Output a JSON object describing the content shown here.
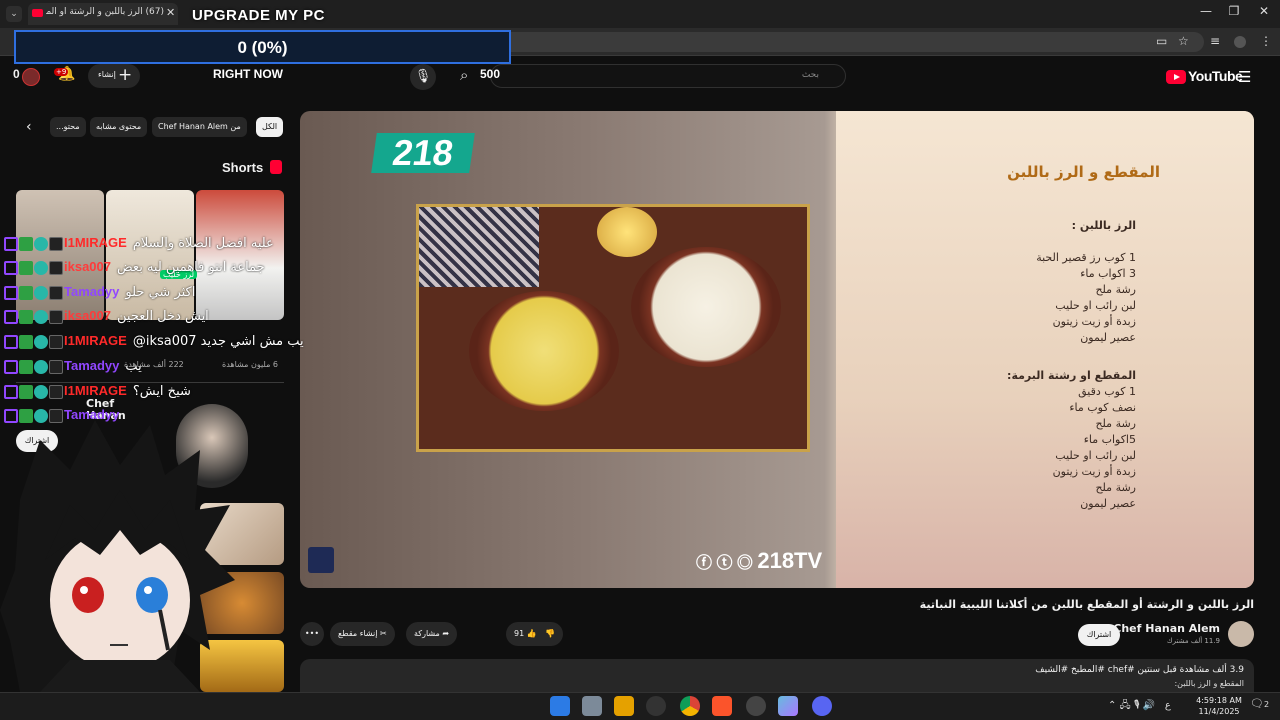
{
  "browser": {
    "tab_count_title": "(67) الرز باللبن و الرشتة أو المقطع...",
    "tab_close": "✕",
    "tab_dropdown": "⌄",
    "window_controls": [
      "—",
      "❐",
      "✕"
    ]
  },
  "overlays": {
    "upgrade_title": "UPGRADE MY PC",
    "progress_text": "0 (0%)",
    "right_now": "RIGHT NOW",
    "counter_500": "500",
    "counter_0": "0"
  },
  "yt_header": {
    "logo_text": "YouTube",
    "search_placeholder": "بحث",
    "create_label": "إنشاء",
    "notification_badge": "+9"
  },
  "chips": [
    "الكل",
    "من Chef Hanan Alem",
    "محتوى مشابه",
    "محتو..."
  ],
  "shorts": {
    "title": "Shorts",
    "items": [
      {
        "views": "222 ألف مشاهدة"
      },
      {
        "views": "6 مليون مشاهدة"
      }
    ],
    "chips_over": [
      "لرز حليب"
    ]
  },
  "player": {
    "logo": "218",
    "recipe_title": "المقطع و الرز باللبن",
    "recipe_lines": [
      {
        "text": "الرز باللبن :",
        "head": true
      },
      {
        "text": "1 كوب رز قصير الحبة",
        "head": false
      },
      {
        "text": "3 اكواب ماء",
        "head": false
      },
      {
        "text": "رشة ملح",
        "head": false
      },
      {
        "text": "لبن رائب او حليب",
        "head": false
      },
      {
        "text": "زبدة أو زيت زيتون",
        "head": false
      },
      {
        "text": "عصير ليمون",
        "head": false
      },
      {
        "text": "المقطع او رشتة البرمة:",
        "head": true
      },
      {
        "text": "1 كوب دقيق",
        "head": false
      },
      {
        "text": "نصف كوب ماء",
        "head": false
      },
      {
        "text": "رشة ملح",
        "head": false
      },
      {
        "text": "5اكواب ماء",
        "head": false
      },
      {
        "text": "لبن رائب او حليب",
        "head": false
      },
      {
        "text": "زبدة أو زيت زيتون",
        "head": false
      },
      {
        "text": "رشة ملح",
        "head": false
      },
      {
        "text": "عصير ليمون",
        "head": false
      }
    ],
    "brand": "218TV"
  },
  "video": {
    "title": "الرز باللبن و الرشتة أو المقطع باللبن من أكلاتنا الليبية النباتية",
    "channel": "Chef Hanan Alem",
    "subscribers": "11.9 ألف مشترك",
    "subscribe": "اشتراك",
    "likes": "91",
    "share": "مشاركة",
    "clip": "إنشاء مقطع",
    "more": "•••",
    "desc_meta": "3.9 ألف مشاهدة  قبل سنتين  #chef #المطبخ #الشيف",
    "desc_line2": "المقطع و الرز باللبن:"
  },
  "chat": [
    {
      "user": "I1MIRAGE",
      "color": "#ff2a2a",
      "msg": "عليه افضل الصلاة والسلام"
    },
    {
      "user": "iksa007",
      "color": "#ff3b3b",
      "msg": "جماعة انتو فاهمين ليه بعض"
    },
    {
      "user": "Tamadyy",
      "color": "#9147ff",
      "msg": "اكثر شي حلو"
    },
    {
      "user": "iksa007",
      "color": "#ff3b3b",
      "msg": "ايش دخل العجين"
    },
    {
      "user": "I1MIRAGE",
      "color": "#ff2a2a",
      "msg": "@iksa007 يب مش اشي جديد"
    },
    {
      "user": "Tamadyy",
      "color": "#9147ff",
      "msg": "يب"
    },
    {
      "user": "I1MIRAGE",
      "color": "#ff2a2a",
      "msg": "شيخ ايش؟"
    },
    {
      "user": "Tamadyy",
      "color": "#9147ff",
      "msg": ""
    }
  ],
  "sidebar_channel": {
    "name": "Chef Hanan",
    "subscribe": "اشتراك"
  },
  "taskbar": {
    "time": "4:59:18 AM",
    "date": "11/4/2025",
    "tray_lang": "ع",
    "notif_count": "2"
  }
}
